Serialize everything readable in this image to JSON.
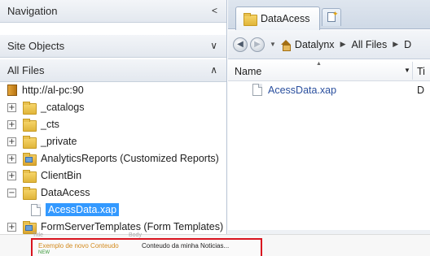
{
  "navigation": {
    "title": "Navigation",
    "site_objects": "Site Objects",
    "all_files": "All Files"
  },
  "tree": [
    {
      "label": "http://al-pc:90",
      "icon": "server-icon",
      "expander": ""
    },
    {
      "label": "_catalogs",
      "icon": "folder-icon",
      "expander": "+"
    },
    {
      "label": "_cts",
      "icon": "folder-icon",
      "expander": "+"
    },
    {
      "label": "_private",
      "icon": "folder-icon",
      "expander": "+"
    },
    {
      "label": "AnalyticsReports (Customized Reports)",
      "icon": "site-folder-icon",
      "expander": "+"
    },
    {
      "label": "ClientBin",
      "icon": "folder-icon",
      "expander": "+"
    },
    {
      "label": "DataAcess",
      "icon": "folder-icon",
      "expander": "−"
    },
    {
      "label": "AcessData.xap",
      "icon": "file-icon",
      "expander": "",
      "selected": true
    },
    {
      "label": "FormServerTemplates (Form Templates)",
      "icon": "site-folder-icon",
      "expander": "+"
    }
  ],
  "tabs": {
    "active": "DataAcess"
  },
  "address": {
    "crumbs": [
      "Datalynx",
      "All Files",
      "D"
    ]
  },
  "columns": {
    "name": "Name",
    "type": "Ti"
  },
  "files": [
    {
      "name": "AcessData.xap",
      "type": "D"
    }
  ],
  "background_page": {
    "ghost_left": "Title",
    "ghost_right": "Body",
    "item_title": "Exemplo de novo Conteudo",
    "item_new": "NEW",
    "item_body": "Conteudo da minha Noticias..."
  },
  "colors": {
    "selection": "#3399ff",
    "highlight_border": "#d9141f",
    "file_link": "#2a4f9e"
  }
}
